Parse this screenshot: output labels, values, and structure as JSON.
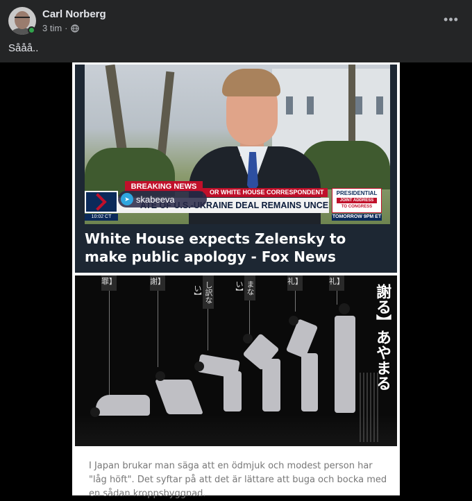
{
  "post": {
    "author": "Carl Norberg",
    "time": "3 tim",
    "separator": "·",
    "text": "Sååå..",
    "more_icon": "ellipsis-icon",
    "privacy_icon": "globe-icon"
  },
  "news": {
    "breaking": "BREAKING NEWS",
    "correspondent": "OR WHITE HOUSE CORRESPONDENT",
    "headline": "ATE OF U.S.-UKRAINE DEAL REMAINS UNCERTAIN",
    "watermark": "skabeeva",
    "time": "10:02 CT",
    "presidential": "PRESIDENTIAL",
    "joint_address": "JOINT ADDRESS",
    "to_congress": "TO CONGRESS",
    "tomorrow": "TOMORROW 9PM ET",
    "caption": "White House expects Zelensky to make public apology - Fox News"
  },
  "bowing": {
    "title": "謝る】あやまる",
    "labels": [
      "罪】",
      "謝】",
      "し訳ない】",
      "まない】",
      "礼】",
      "礼】"
    ]
  },
  "article_text": "I Japan brukar man säga att en ödmjuk och modest person har \"låg höft\". Det syftar på att det är lättare att buga och bocka med en sådan kroppsbyggnad."
}
